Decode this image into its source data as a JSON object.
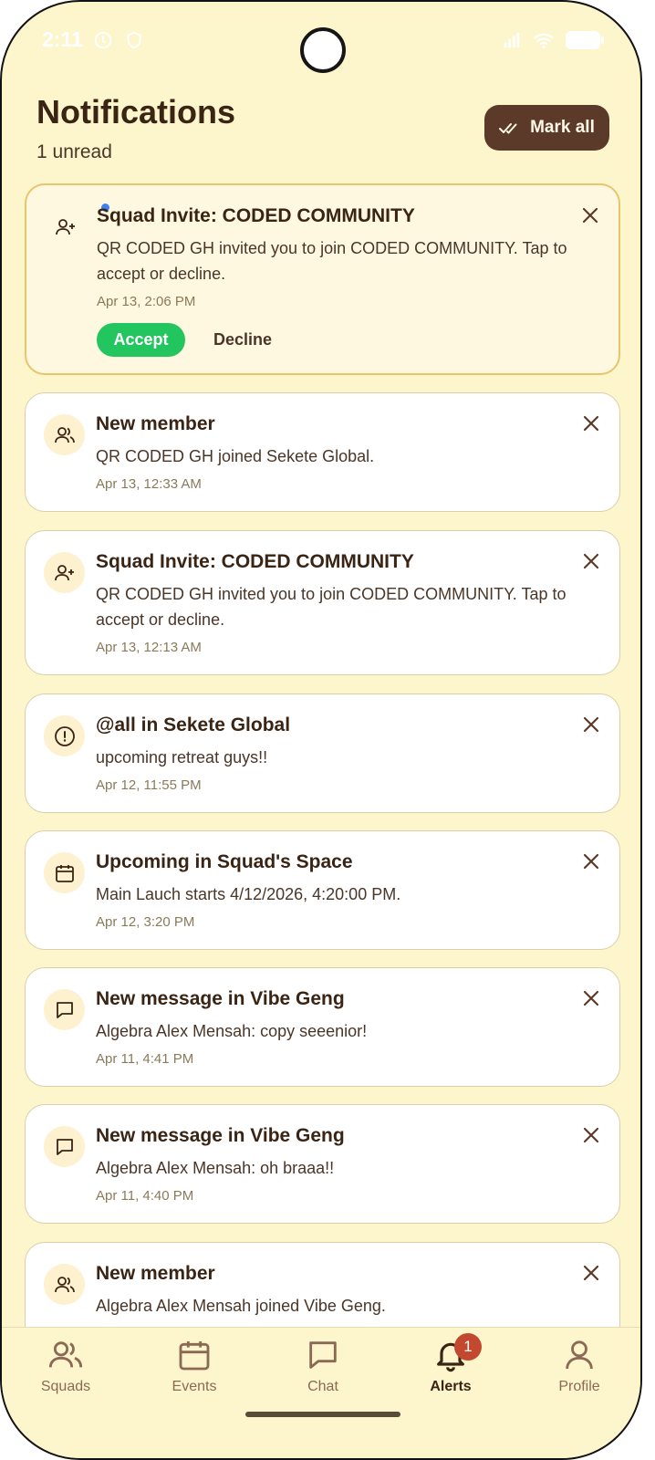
{
  "status_bar": {
    "time": "2:11"
  },
  "header": {
    "title": "Notifications",
    "subtitle": "1 unread",
    "mark_all_label": "Mark all"
  },
  "notifications": [
    {
      "icon": "user-plus-icon",
      "title": "Squad Invite: CODED COMMUNITY",
      "body": "QR CODED GH invited you to join CODED COMMUNITY. Tap to accept or decline.",
      "time": "Apr 13, 2:06 PM",
      "unread": true,
      "accept_label": "Accept",
      "decline_label": "Decline"
    },
    {
      "icon": "users-icon",
      "title": "New member",
      "body": "QR CODED GH joined Sekete Global.",
      "time": "Apr 13, 12:33 AM"
    },
    {
      "icon": "user-plus-icon",
      "title": "Squad Invite: CODED COMMUNITY",
      "body": "QR CODED GH invited you to join CODED COMMUNITY. Tap to accept or decline.",
      "time": "Apr 13, 12:13 AM"
    },
    {
      "icon": "alert-circle-icon",
      "title": "@all in Sekete Global",
      "body": "upcoming retreat guys!!",
      "time": "Apr 12, 11:55 PM"
    },
    {
      "icon": "calendar-icon",
      "title": "Upcoming in Squad's Space",
      "body": "Main Lauch starts 4/12/2026, 4:20:00 PM.",
      "time": "Apr 12, 3:20 PM"
    },
    {
      "icon": "message-icon",
      "title": "New message in Vibe Geng",
      "body": "Algebra Alex Mensah: copy seeenior!",
      "time": "Apr 11, 4:41 PM"
    },
    {
      "icon": "message-icon",
      "title": "New message in Vibe Geng",
      "body": "Algebra Alex Mensah: oh braaa!!",
      "time": "Apr 11, 4:40 PM"
    },
    {
      "icon": "users-icon",
      "title": "New member",
      "body": "Algebra Alex Mensah joined Vibe Geng.",
      "time": ""
    }
  ],
  "tabs": [
    {
      "label": "Squads",
      "icon": "users-icon"
    },
    {
      "label": "Events",
      "icon": "calendar-icon"
    },
    {
      "label": "Chat",
      "icon": "message-icon"
    },
    {
      "label": "Alerts",
      "icon": "bell-icon",
      "badge": "1",
      "active": true
    },
    {
      "label": "Profile",
      "icon": "user-icon"
    }
  ],
  "colors": {
    "background": "#fdf5cb",
    "accent_brown": "#5c3a29",
    "accept_green": "#22c55e",
    "badge_red": "#c2492f",
    "unread_dot": "#3b82f6"
  }
}
